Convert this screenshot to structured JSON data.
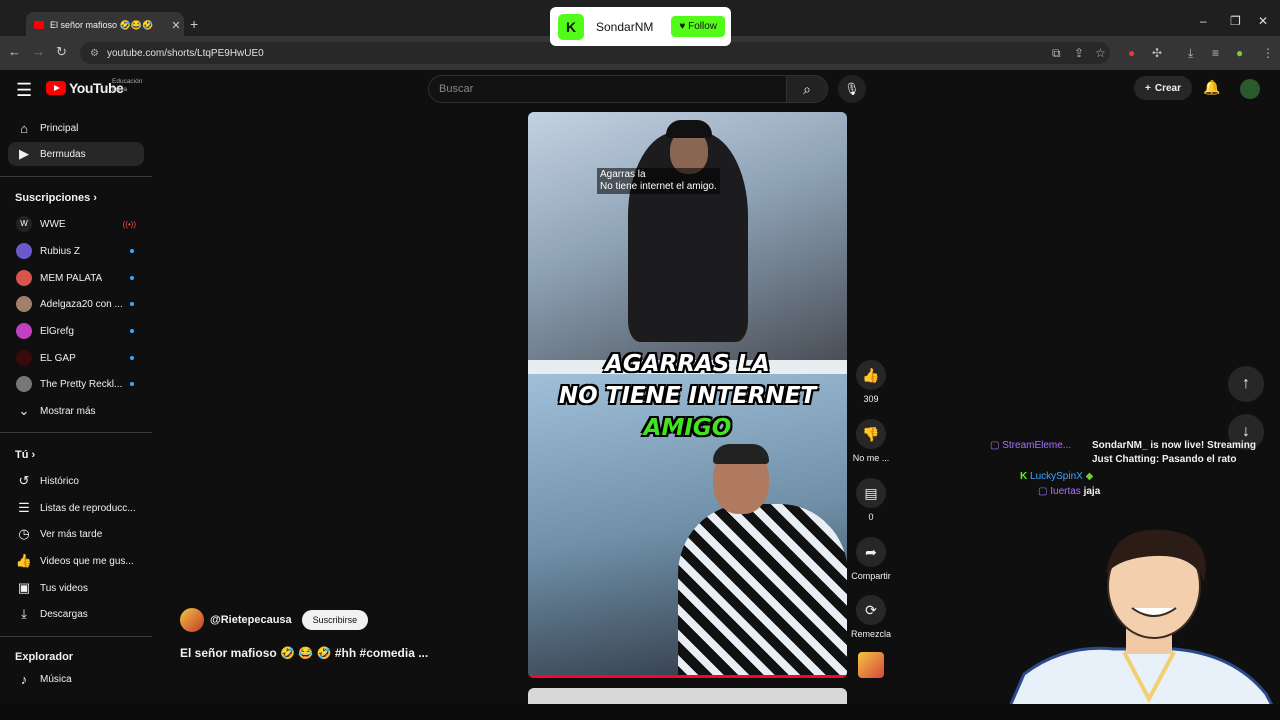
{
  "browser": {
    "tab_title": "El señor mafioso 🤣😂🤣",
    "url": "youtube.com/shorts/LtqPE9HwUE0"
  },
  "youtube": {
    "brand": "YouTube",
    "brand_sub_1": "Educación",
    "brand_sub_2": "física",
    "search_placeholder": "Buscar",
    "create_label": "Crear"
  },
  "sidebar": {
    "main": [
      {
        "label": "Principal",
        "icon": "home-icon"
      },
      {
        "label": "Bermudas",
        "icon": "shorts-icon"
      }
    ],
    "subs_header": "Suscripciones",
    "subs": [
      {
        "label": "WWE",
        "live": "((•))"
      },
      {
        "label": "Rubius Z"
      },
      {
        "label": "MEM PALATA"
      },
      {
        "label": "Adelgaza20 con ..."
      },
      {
        "label": "ElGrefg"
      },
      {
        "label": "EL GAP"
      },
      {
        "label": "The Pretty Reckl..."
      }
    ],
    "show_more": "Mostrar más",
    "you_header": "Tú",
    "you": [
      {
        "label": "Histórico",
        "icon": "history-icon"
      },
      {
        "label": "Listas de reproducc...",
        "icon": "playlist-icon"
      },
      {
        "label": "Ver más tarde",
        "icon": "clock-icon"
      },
      {
        "label": "Videos que me gus...",
        "icon": "like-icon"
      },
      {
        "label": "Tus videos",
        "icon": "video-icon"
      },
      {
        "label": "Descargas",
        "icon": "download-icon"
      }
    ],
    "explore_header": "Explorador",
    "explore": [
      {
        "label": "Música",
        "icon": "music-icon"
      }
    ]
  },
  "video": {
    "small_caption_1": "Agarras la",
    "small_caption_2": "No tiene internet el amigo.",
    "big_caption_1": "AGARRAS LA",
    "big_caption_2": "NO TIENE INTERNET",
    "big_caption_3": "AMIGO",
    "channel": "@Rietepecausa",
    "subscribe": "Suscribirse",
    "title": "El señor mafioso 🤣 😂 🤣 #hh  #comedia  ..."
  },
  "actions": {
    "likes": "309",
    "dislike": "No me ...",
    "comments": "0",
    "share": "Compartir",
    "remix": "Remezcla"
  },
  "overlay": {
    "follow_name": "SondarNM",
    "follow_button": "Follow",
    "chat": [
      {
        "user": "StreamEleme...",
        "msg": "SondarNM_ is now live! Streaming"
      },
      {
        "user": "",
        "msg": "Just Chatting: Pasando el rato"
      },
      {
        "user": "LuckySpinX",
        "msg": ""
      },
      {
        "user": "Iuertas",
        "msg": "jaja"
      }
    ]
  }
}
